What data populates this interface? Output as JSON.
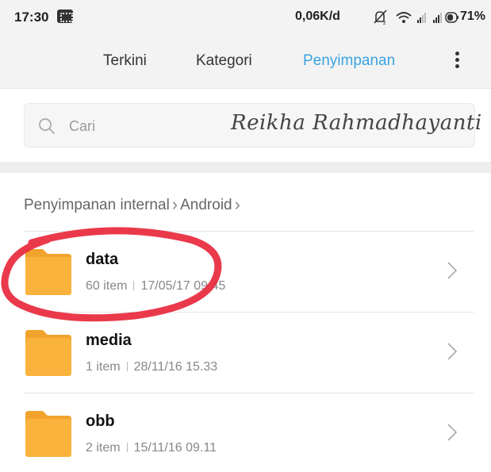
{
  "status_bar": {
    "time": "17:30",
    "net_speed": "0,06K/d",
    "battery_percent": "71%",
    "battery_level": 0.71,
    "icons": [
      "bbm-icon",
      "mute-icon",
      "wifi-icon",
      "signal-icon",
      "signal-icon",
      "battery-icon"
    ]
  },
  "tabs": [
    {
      "label": "Terkini",
      "active": false
    },
    {
      "label": "Kategori",
      "active": false
    },
    {
      "label": "Penyimpanan",
      "active": true
    }
  ],
  "search": {
    "placeholder": "Cari",
    "watermark": "Reikha Rahmadhayanti"
  },
  "breadcrumb": {
    "items": [
      "Penyimpanan internal",
      "Android"
    ]
  },
  "files": [
    {
      "name": "data",
      "count": "60 item",
      "date": "17/05/17 09.45"
    },
    {
      "name": "media",
      "count": "1 item",
      "date": "28/11/16 15.33"
    },
    {
      "name": "obb",
      "count": "2 item",
      "date": "15/11/16 09.11"
    }
  ],
  "colors": {
    "accent": "#3aa3e0",
    "folder": "#f9b23c",
    "folder_tab": "#f2a32d",
    "annotation": "#e8283c"
  }
}
